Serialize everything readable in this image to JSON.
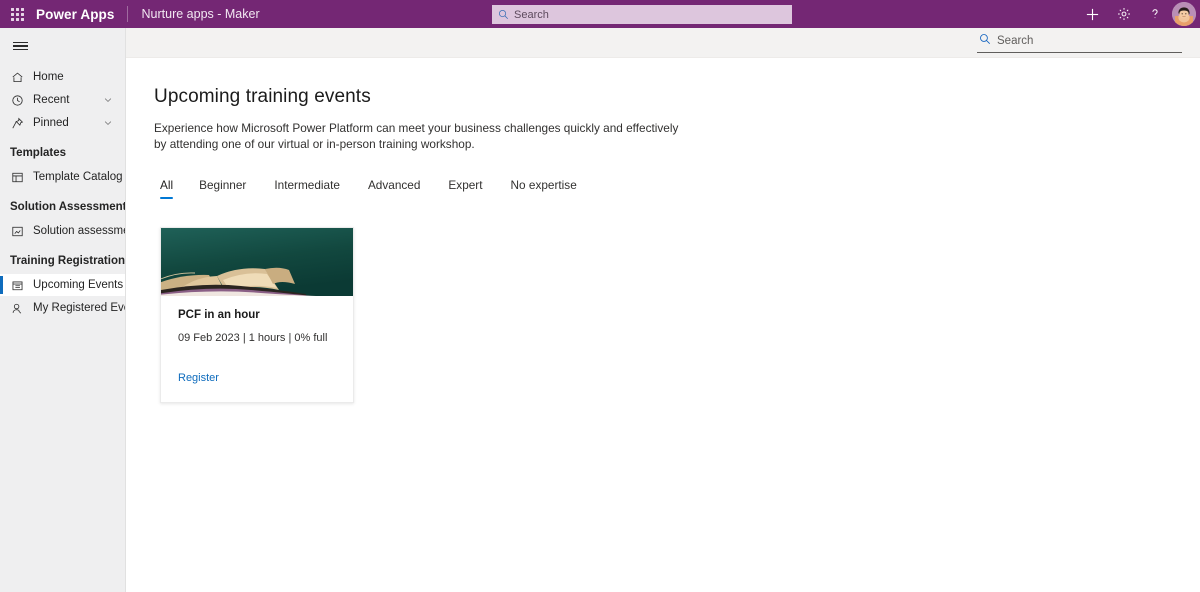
{
  "suitebar": {
    "waffle_label": "app-launcher",
    "brand": "Power Apps",
    "app_name": "Nurture apps - Maker",
    "search_placeholder": "Search",
    "search_value": "",
    "actions": [
      {
        "name": "new-button",
        "glyph": "+"
      },
      {
        "name": "settings-button",
        "glyph": "gear"
      },
      {
        "name": "help-button",
        "glyph": "?"
      }
    ],
    "accent_color": "#742774",
    "search_bg": "#ddc6dd"
  },
  "sidebar": {
    "items": [
      {
        "label": "Home",
        "icon": "home-icon",
        "expandable": false,
        "selected": false
      },
      {
        "label": "Recent",
        "icon": "clock-icon",
        "expandable": true,
        "selected": false
      },
      {
        "label": "Pinned",
        "icon": "pin-icon",
        "expandable": true,
        "selected": false
      }
    ],
    "groups": [
      {
        "title": "Templates",
        "items": [
          {
            "label": "Template Catalog",
            "icon": "template-icon",
            "selected": false
          }
        ]
      },
      {
        "title": "Solution Assessment",
        "items": [
          {
            "label": "Solution assessment",
            "icon": "assessment-icon",
            "selected": false
          }
        ]
      },
      {
        "title": "Training Registration",
        "items": [
          {
            "label": "Upcoming Events",
            "icon": "calendar-events-icon",
            "selected": true
          },
          {
            "label": "My Registered Events",
            "icon": "person-icon",
            "selected": false
          }
        ]
      }
    ],
    "selected_indicator_color": "#0f6cbd",
    "background": "#efeff0"
  },
  "commandbar": {
    "search_placeholder": "Search",
    "search_value": ""
  },
  "main": {
    "title": "Upcoming training events",
    "description": "Experience how Microsoft Power Platform can meet your business challenges quickly and effectively by attending one of our virtual or in-person training workshop.",
    "tabs": [
      {
        "label": "All",
        "active": true
      },
      {
        "label": "Beginner",
        "active": false
      },
      {
        "label": "Intermediate",
        "active": false
      },
      {
        "label": "Advanced",
        "active": false
      },
      {
        "label": "Expert",
        "active": false
      },
      {
        "label": "No expertise",
        "active": false
      }
    ],
    "tab_accent_color": "#0078d4",
    "cards": [
      {
        "image_alt": "open-book-on-teal-background",
        "title": "PCF in an hour",
        "meta": "09 Feb 2023 | 1 hours | 0% full",
        "link_label": "Register",
        "link_color": "#0f6cbd"
      }
    ]
  }
}
